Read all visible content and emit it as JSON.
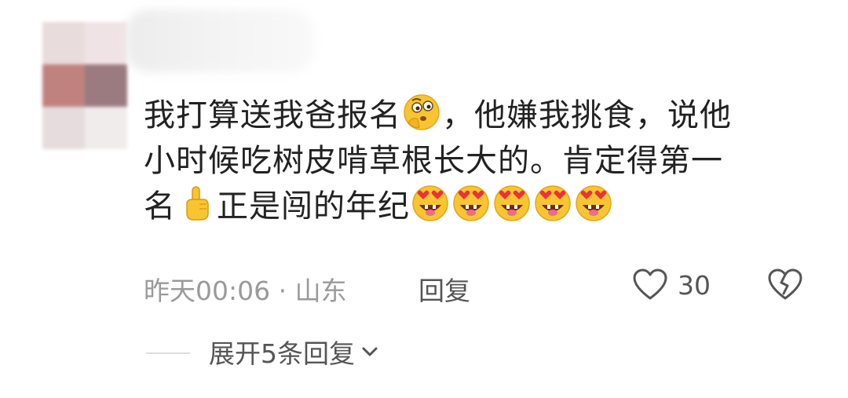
{
  "comment": {
    "line1": {
      "text_a": "我打算送我爸报名",
      "emoji_a": "thinking-face",
      "text_b": "，他嫌我挑食，说他"
    },
    "line2": {
      "text": "小时候吃树皮啃草根长大的。肯定得第一"
    },
    "line3": {
      "text_a": "名",
      "emoji_a": "index-pointing-up",
      "text_b": "正是闯的年纪",
      "emojis": [
        "star-struck-drooling",
        "star-struck-drooling",
        "star-struck-drooling",
        "star-struck-drooling",
        "star-struck-drooling"
      ]
    }
  },
  "meta": {
    "time_location": "昨天00:06 · 山东",
    "reply_label": "回复",
    "like_icon": "heart-outline-icon",
    "like_count": "30",
    "dislike_icon": "broken-heart-icon"
  },
  "replies": {
    "expand_label": "展开5条回复",
    "expand_icon": "chevron-down-icon"
  },
  "colors": {
    "text_primary": "#222222",
    "text_secondary": "#9a9a9a",
    "text_action": "#555555",
    "emoji_yellow": "#f7c531"
  }
}
